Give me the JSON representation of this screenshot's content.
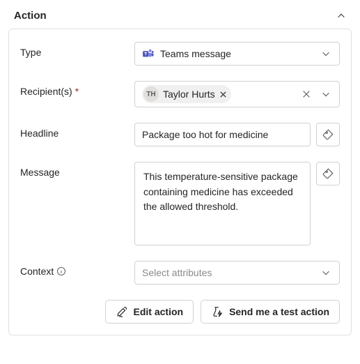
{
  "header": {
    "title": "Action"
  },
  "fields": {
    "type": {
      "label": "Type",
      "value": "Teams message"
    },
    "recipients": {
      "label": "Recipient(s)",
      "required_marker": "*",
      "chip": {
        "initials": "TH",
        "name": "Taylor Hurts"
      }
    },
    "headline": {
      "label": "Headline",
      "value": "Package too hot for medicine"
    },
    "message": {
      "label": "Message",
      "value": "This temperature-sensitive package containing medicine has exceeded the allowed threshold."
    },
    "context": {
      "label": "Context",
      "placeholder": "Select attributes"
    }
  },
  "buttons": {
    "edit": "Edit action",
    "test": "Send me a test action"
  }
}
